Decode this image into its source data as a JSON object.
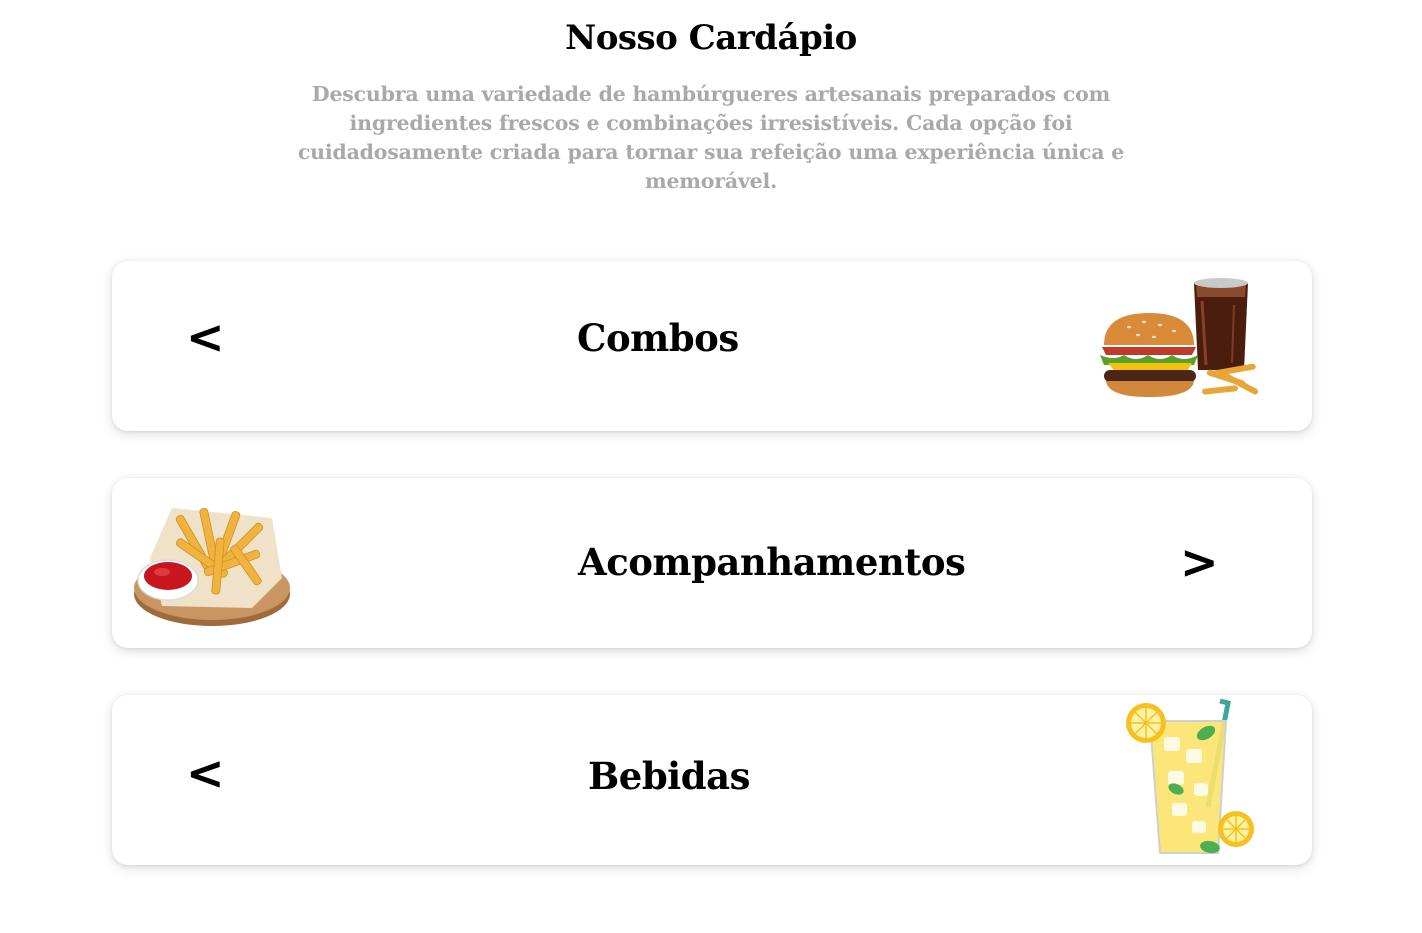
{
  "header": {
    "title": "Nosso Cardápio",
    "description": "Descubra uma variedade de hambúrgueres artesanais preparados com ingredientes frescos e combinações irresistíveis. Cada opção foi cuidadosamente criada para tornar sua refeição uma experiência única e memorável."
  },
  "categories": [
    {
      "label": "Combos",
      "arrow": "<",
      "icon": "burger-combo-image"
    },
    {
      "label": "Acompanhamentos",
      "arrow": ">",
      "icon": "fries-image"
    },
    {
      "label": "Bebidas",
      "arrow": "<",
      "icon": "lemonade-image"
    }
  ]
}
